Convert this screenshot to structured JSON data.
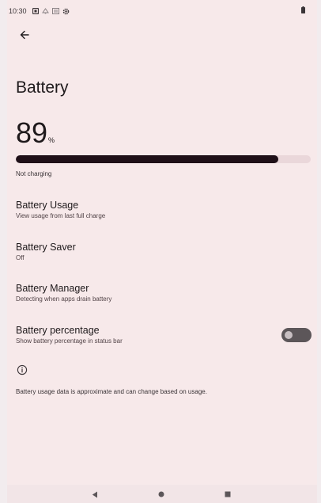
{
  "status_bar": {
    "time": "10:30",
    "icons": [
      "notification-icon",
      "signal-icon",
      "sim-icon",
      "settings-icon"
    ],
    "battery_icon": "battery-icon"
  },
  "header": {
    "back_icon": "back-arrow-icon",
    "title": "Battery"
  },
  "battery": {
    "level": "89",
    "unit": "%",
    "level_fraction": 0.89,
    "status": "Not charging"
  },
  "preferences": [
    {
      "title": "Battery Usage",
      "summary": "View usage from last full charge"
    },
    {
      "title": "Battery Saver",
      "summary": "Off"
    },
    {
      "title": "Battery Manager",
      "summary": "Detecting when apps drain battery"
    },
    {
      "title": "Battery percentage",
      "summary": "Show battery percentage in status bar",
      "toggle_on": false
    }
  ],
  "footer": {
    "info_icon": "info-icon",
    "text": "Battery usage data is approximate and can change based on usage."
  },
  "nav_bar": {
    "back": "nav-back-icon",
    "home": "nav-home-icon",
    "recents": "nav-recents-icon"
  },
  "colors": {
    "background": "#f7e9ea",
    "bar_fill": "#1f1018",
    "bar_track": "#ead7da",
    "toggle_off_track": "#5c5659"
  }
}
